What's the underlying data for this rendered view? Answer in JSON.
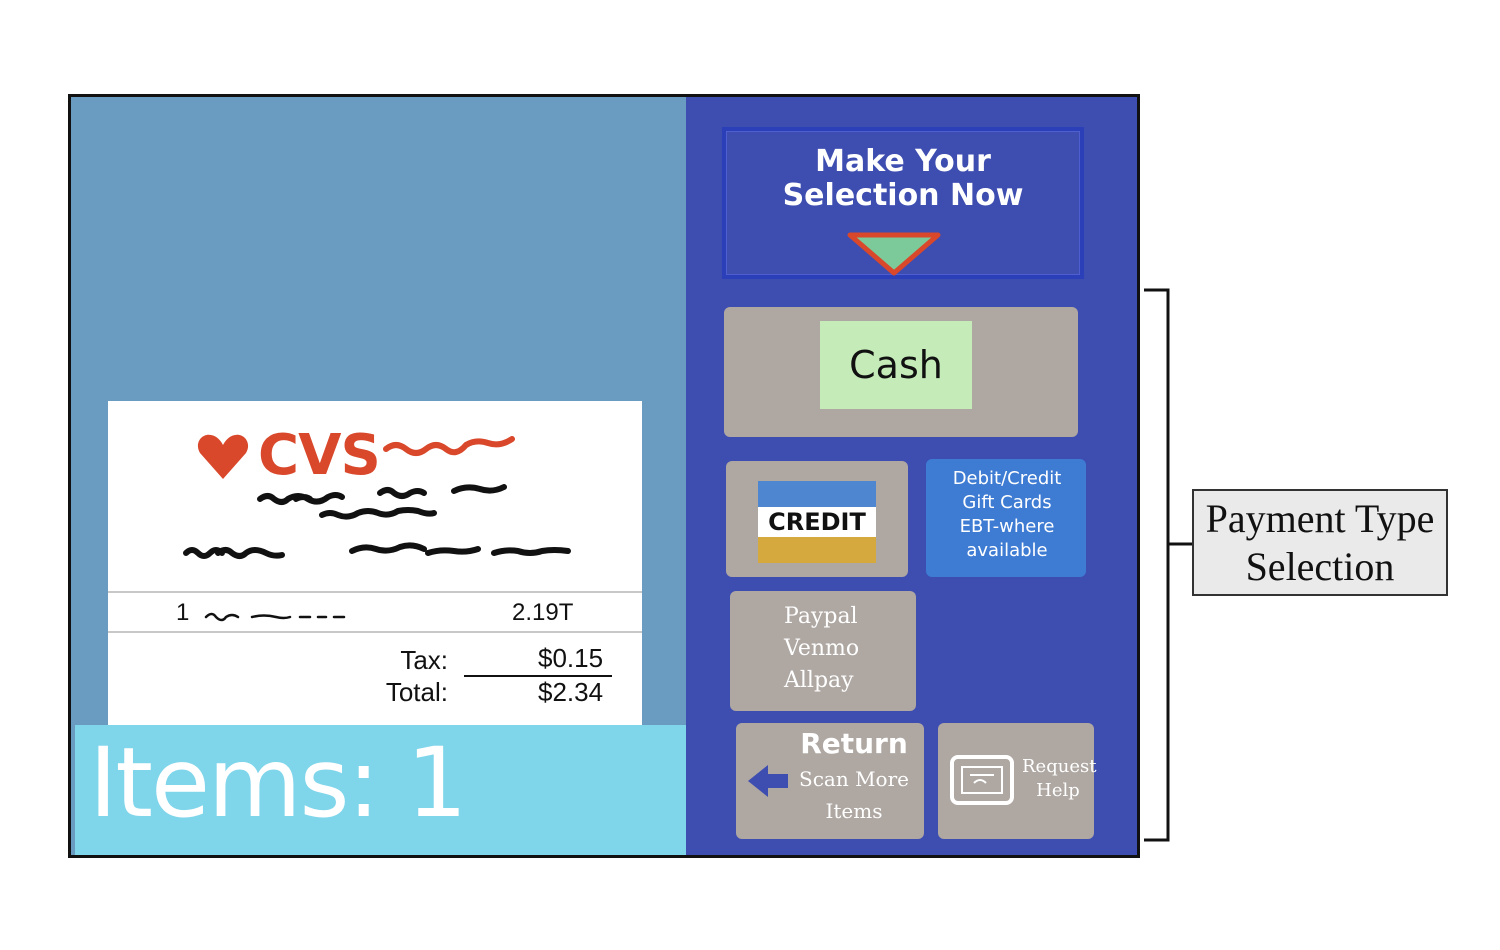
{
  "receipt": {
    "store": "CVS",
    "line_item": {
      "qty": "1",
      "price": "2.19T"
    },
    "tax_label": "Tax:",
    "tax_value": "$0.15",
    "total_label": "Total:",
    "total_value": "$2.34"
  },
  "items_bar": {
    "label": "Items: 1"
  },
  "prompt": {
    "line1": "Make Your",
    "line2": "Selection Now"
  },
  "payment": {
    "cash_label": "Cash",
    "credit_label": "CREDIT",
    "debit_lines": [
      "Debit/Credit",
      "Gift Cards",
      "EBT-where",
      "available"
    ],
    "paypal_lines": [
      "Paypal",
      "Venmo",
      "Allpay"
    ]
  },
  "return_button": {
    "title": "Return",
    "sub_lines": [
      "Scan More",
      "Items"
    ]
  },
  "help_button": {
    "lines": [
      "Request",
      "Help"
    ]
  },
  "annotation": {
    "lines": [
      "Payment Type",
      "Selection"
    ]
  },
  "colors": {
    "left_bg": "#6a9bc1",
    "right_bg": "#3d4db0",
    "items_bar": "#7fd5ea",
    "tile": "#aea7a2",
    "cash_inner": "#c4ebb8",
    "debit_tile": "#3e7bd3",
    "cvs_red": "#d9482b",
    "arrow_fill": "#7cc99a",
    "arrow_stroke": "#d9482b"
  }
}
